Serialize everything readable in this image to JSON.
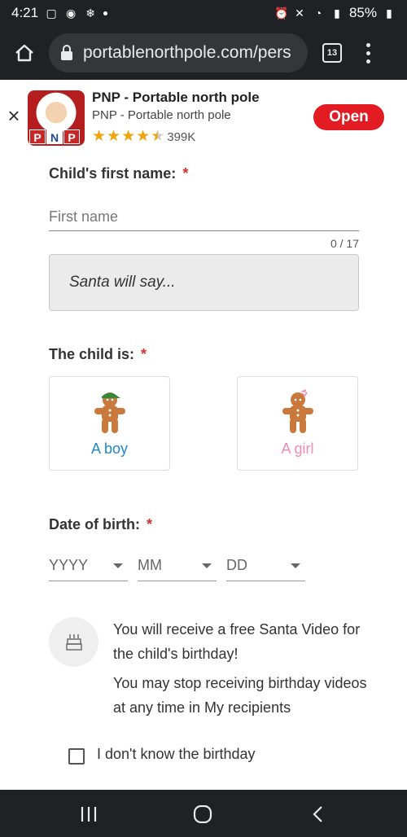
{
  "status_bar": {
    "time": "4:21",
    "battery": "85%"
  },
  "browser": {
    "url": "portablenorthpole.com/pers​",
    "tab_count": "13"
  },
  "app_banner": {
    "icon_letters": [
      "P",
      "N",
      "P"
    ],
    "title": "PNP - Portable north pole",
    "subtitle": "PNP - Portable north pole",
    "rating_stars": 4.5,
    "rating_count": "399K",
    "open_label": "Open"
  },
  "form": {
    "name_label": "Child's first name:",
    "required_mark": "*",
    "name_placeholder": "First name",
    "name_value": "",
    "char_counter": "0 / 17",
    "santa_preview": "Santa will say...",
    "gender_label": "The child is:",
    "boy_label": "A boy",
    "girl_label": "A girl",
    "dob_label": "Date of birth:",
    "year_select": "YYYY",
    "month_select": "MM",
    "day_select": "DD",
    "birthday_info_1": "You will receive a free Santa Video for the child's birthday!",
    "birthday_info_2": "You may stop receiving birthday videos at any time in My recipients",
    "unknown_birthday_label": "I don't know the birthday",
    "unknown_birthday_checked": false
  },
  "colors": {
    "boy_accent": "#1e88c8",
    "girl_accent": "#f08ab8",
    "open_button": "#e31b23",
    "required": "#d32f2f",
    "star": "#f0a30a"
  }
}
